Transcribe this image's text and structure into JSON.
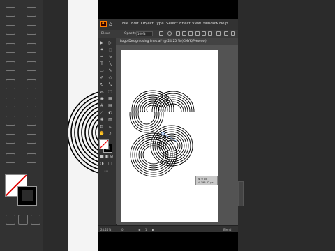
{
  "menu": {
    "logo": "Ai",
    "items": [
      "File",
      "Edit",
      "Object",
      "Type",
      "Select",
      "Effect",
      "View",
      "Window",
      "Help"
    ]
  },
  "control_bar": {
    "object_label": "Blend",
    "opacity_label": "Opacity:",
    "opacity_value": "100%"
  },
  "document_tab": {
    "title": "Logo Design using lines.ai* @ 24.25 % (CMYK/Preview)",
    "close": "×"
  },
  "tooltip": {
    "line1": "W: 0 px",
    "line2": "H: 195.82 px"
  },
  "status_bar": {
    "zoom": "24.25%",
    "angle": "0°",
    "artboard": "1",
    "tool": "Blend"
  },
  "colors": {
    "app_bg": "#535353",
    "panel_bg": "#323232",
    "menu_text": "#d8d8d8",
    "accent_orange": "#ff7c00",
    "artboard": "#ffffff",
    "art": "#000000"
  }
}
